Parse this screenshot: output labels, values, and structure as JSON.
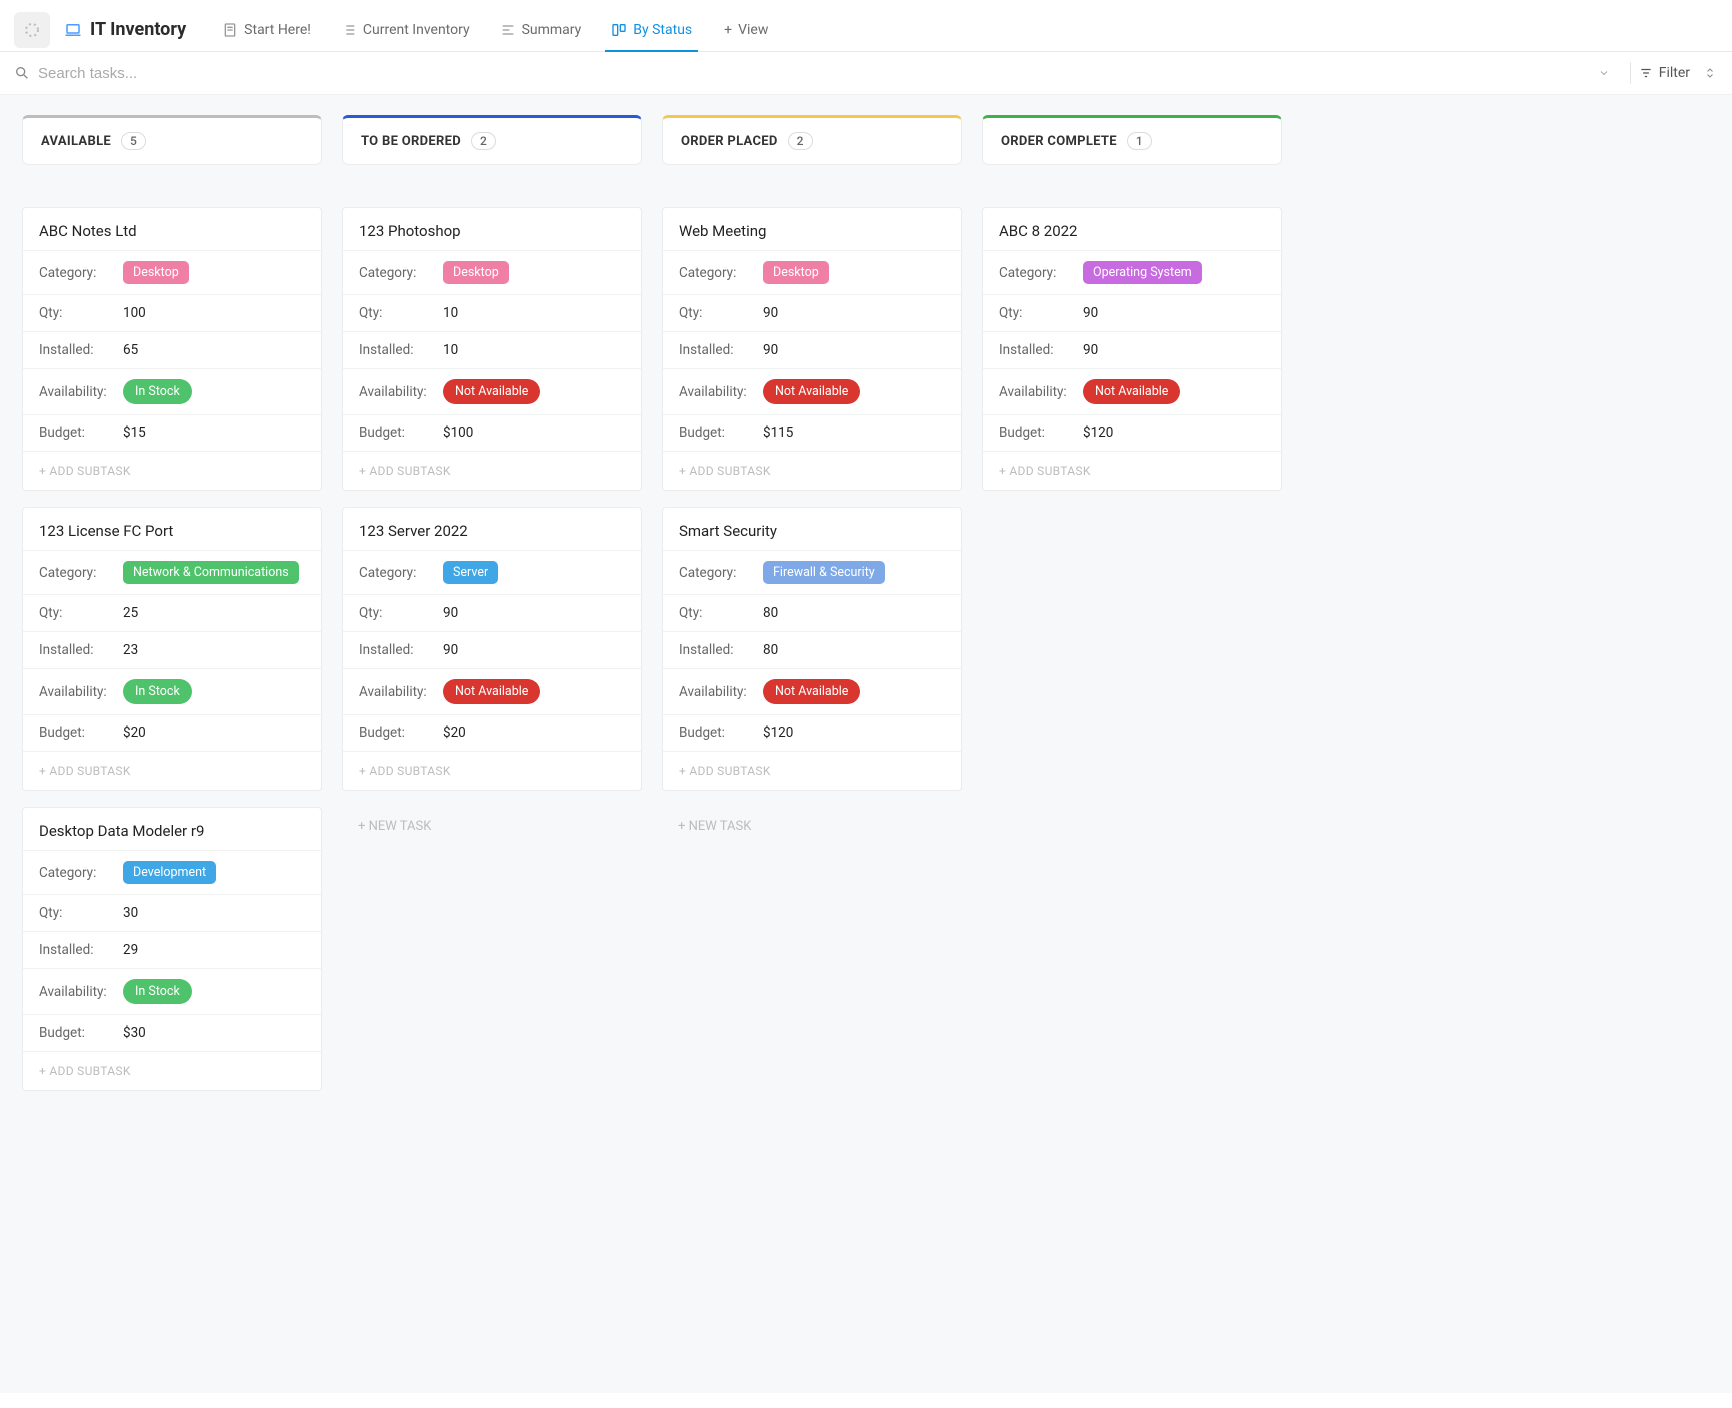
{
  "header": {
    "title": "IT Inventory",
    "tabs": [
      {
        "label": "Start Here!",
        "active": false,
        "icon": "doc"
      },
      {
        "label": "Current Inventory",
        "active": false,
        "icon": "list"
      },
      {
        "label": "Summary",
        "active": false,
        "icon": "summary"
      },
      {
        "label": "By Status",
        "active": true,
        "icon": "board"
      }
    ],
    "add_view_label": "View"
  },
  "search": {
    "placeholder": "Search tasks...",
    "filter_label": "Filter"
  },
  "labels": {
    "category": "Category:",
    "qty": "Qty:",
    "installed": "Installed:",
    "availability": "Availability:",
    "budget": "Budget:",
    "add_subtask": "+ ADD SUBTASK",
    "new_task": "+ NEW TASK"
  },
  "category_colors": {
    "Desktop": "#f07fa5",
    "Network & Communications": "#4fc36b",
    "Development": "#3fa7e6",
    "Server": "#3fa7e6",
    "Firewall & Security": "#7fa9e6",
    "Operating System": "#c86ae0"
  },
  "availability_colors": {
    "In Stock": "#4fc36b",
    "Not Available": "#d9362f"
  },
  "columns": [
    {
      "name": "AVAILABLE",
      "count": "5",
      "accent": "#bdbdbd",
      "show_new_task": false,
      "cards": [
        {
          "title": "ABC Notes Ltd",
          "category": "Desktop",
          "qty": "100",
          "installed": "65",
          "availability": "In Stock",
          "budget": "$15"
        },
        {
          "title": "123 License FC Port",
          "category": "Network & Communications",
          "qty": "25",
          "installed": "23",
          "availability": "In Stock",
          "budget": "$20"
        },
        {
          "title": "Desktop Data Modeler r9",
          "category": "Development",
          "qty": "30",
          "installed": "29",
          "availability": "In Stock",
          "budget": "$30"
        }
      ]
    },
    {
      "name": "TO BE ORDERED",
      "count": "2",
      "accent": "#2a5bd7",
      "show_new_task": true,
      "cards": [
        {
          "title": "123 Photoshop",
          "category": "Desktop",
          "qty": "10",
          "installed": "10",
          "availability": "Not Available",
          "budget": "$100"
        },
        {
          "title": "123 Server 2022",
          "category": "Server",
          "qty": "90",
          "installed": "90",
          "availability": "Not Available",
          "budget": "$20"
        }
      ]
    },
    {
      "name": "ORDER PLACED",
      "count": "2",
      "accent": "#f2c94c",
      "show_new_task": true,
      "cards": [
        {
          "title": "Web Meeting",
          "category": "Desktop",
          "qty": "90",
          "installed": "90",
          "availability": "Not Available",
          "budget": "$115"
        },
        {
          "title": "Smart Security",
          "category": "Firewall & Security",
          "qty": "80",
          "installed": "80",
          "availability": "Not Available",
          "budget": "$120"
        }
      ]
    },
    {
      "name": "ORDER COMPLETE",
      "count": "1",
      "accent": "#3bb24a",
      "show_new_task": false,
      "cards": [
        {
          "title": "ABC 8 2022",
          "category": "Operating System",
          "qty": "90",
          "installed": "90",
          "availability": "Not Available",
          "budget": "$120"
        }
      ]
    }
  ]
}
